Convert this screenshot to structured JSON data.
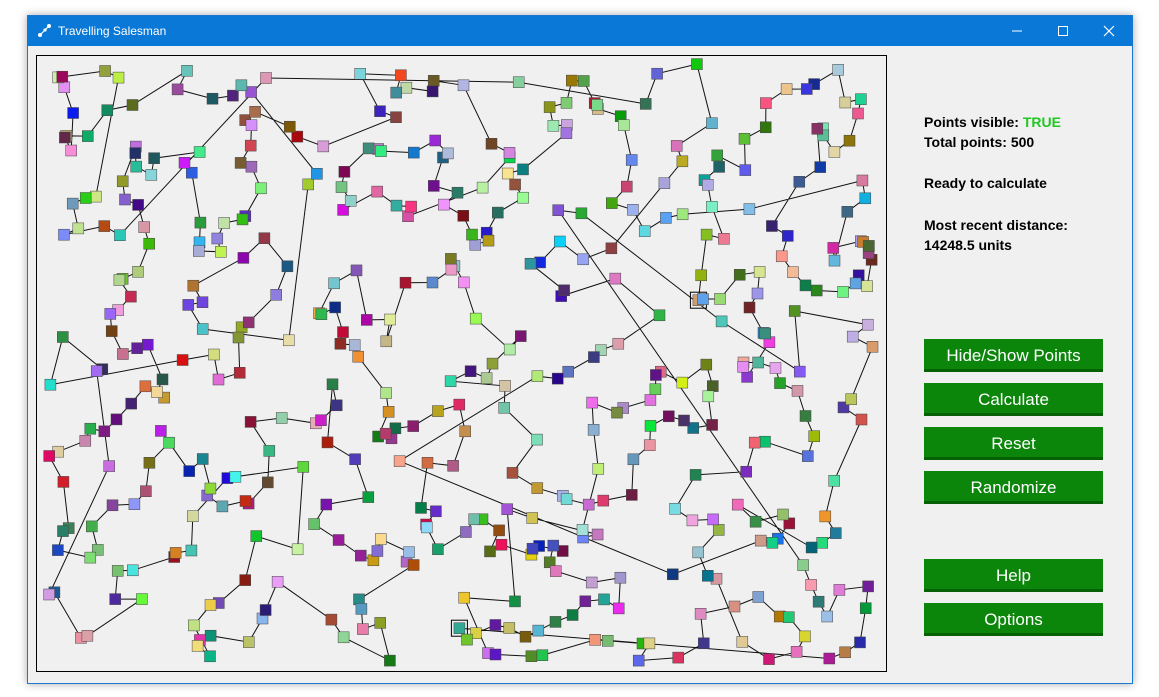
{
  "window": {
    "title": "Travelling Salesman"
  },
  "status": {
    "points_visible_label": "Points visible:",
    "points_visible_value": "TRUE",
    "total_points": "Total points: 500",
    "ready": "Ready to calculate",
    "distance_label": "Most recent distance:",
    "distance_value": "14248.5 units"
  },
  "buttons": {
    "hide_show": "Hide/Show Points",
    "calculate": "Calculate",
    "reset": "Reset",
    "randomize": "Randomize",
    "help": "Help",
    "options": "Options"
  },
  "colors": {
    "titlebar": "#0a78d7",
    "button": "#0b860b",
    "accent_true": "#22c722"
  },
  "route": {
    "point_count": 500,
    "highlighted_points": 2
  }
}
